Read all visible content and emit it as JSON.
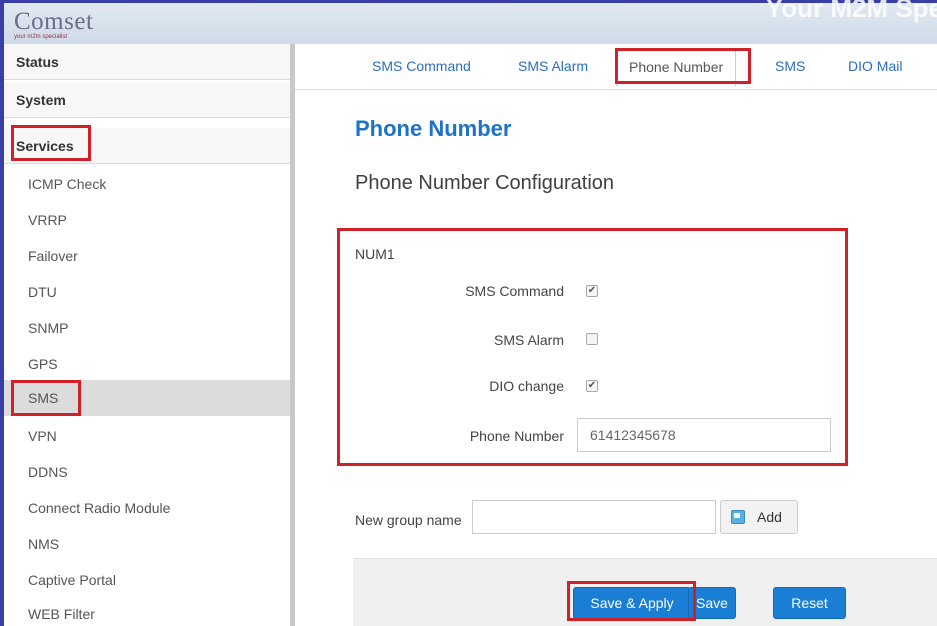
{
  "header": {
    "logo": "Comset",
    "logo_sub": "your m2m specialist",
    "tagline": "Your M2M Spe"
  },
  "sidebar": {
    "categories": [
      {
        "label": "Status"
      },
      {
        "label": "System"
      },
      {
        "label": "Services"
      }
    ],
    "items": [
      {
        "label": "ICMP Check"
      },
      {
        "label": "VRRP"
      },
      {
        "label": "Failover"
      },
      {
        "label": "DTU"
      },
      {
        "label": "SNMP"
      },
      {
        "label": "GPS"
      },
      {
        "label": "SMS"
      },
      {
        "label": "VPN"
      },
      {
        "label": "DDNS"
      },
      {
        "label": "Connect Radio Module"
      },
      {
        "label": "NMS"
      },
      {
        "label": "Captive Portal"
      },
      {
        "label": "WEB Filter"
      }
    ]
  },
  "tabs": [
    {
      "label": "SMS Command"
    },
    {
      "label": "SMS Alarm"
    },
    {
      "label": "Phone Number"
    },
    {
      "label": "SMS"
    },
    {
      "label": "DIO Mail"
    }
  ],
  "main": {
    "title": "Phone Number",
    "section": "Phone Number Configuration",
    "group": {
      "legend": "NUM1",
      "sms_command_label": "SMS Command",
      "sms_command_checked": true,
      "sms_alarm_label": "SMS Alarm",
      "sms_alarm_checked": false,
      "dio_change_label": "DIO change",
      "dio_change_checked": true,
      "phone_label": "Phone Number",
      "phone_value": "61412345678"
    },
    "new_group_label": "New group name",
    "new_group_value": "",
    "add_label": "Add"
  },
  "buttons": {
    "save_apply": "Save & Apply",
    "save": "Save",
    "reset": "Reset"
  },
  "colors": {
    "accent": "#1a7ed4",
    "highlight": "#d0202a",
    "link": "#2a6fbf"
  }
}
